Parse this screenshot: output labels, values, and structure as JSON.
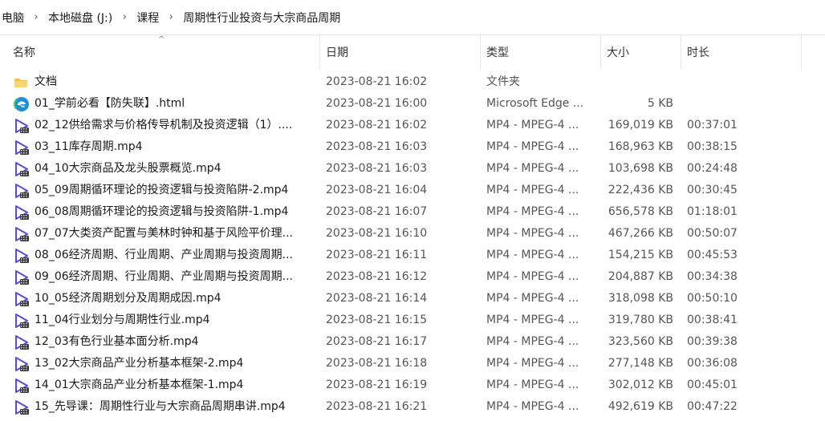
{
  "breadcrumb": [
    "电脑",
    "本地磁盘 (J:)",
    "课程",
    "周期性行业投资与大宗商品周期"
  ],
  "breadcrumb_separator": "›",
  "columns": {
    "name": "名称",
    "date": "日期",
    "type": "类型",
    "size": "大小",
    "duration": "时长"
  },
  "sort_indicator": "^",
  "colors": {
    "folder": "#f2c14e",
    "edge": "#1f8fd6",
    "video": "#5b4bd1"
  },
  "files": [
    {
      "icon": "folder-icon",
      "name": "文档",
      "date": "2023-08-21 16:02",
      "type": "文件夹",
      "size": "",
      "duration": ""
    },
    {
      "icon": "edge-browser-icon",
      "name": "01_学前必看【防失联】.html",
      "date": "2023-08-21 16:00",
      "type": "Microsoft Edge ...",
      "size": "5 KB",
      "duration": ""
    },
    {
      "icon": "video-file-icon",
      "name": "02_12供给需求与价格传导机制及投资逻辑（1）....",
      "date": "2023-08-21 16:02",
      "type": "MP4 - MPEG-4 ...",
      "size": "169,019 KB",
      "duration": "00:37:01"
    },
    {
      "icon": "video-file-icon",
      "name": "03_11库存周期.mp4",
      "date": "2023-08-21 16:03",
      "type": "MP4 - MPEG-4 ...",
      "size": "168,963 KB",
      "duration": "00:38:15"
    },
    {
      "icon": "video-file-icon",
      "name": "04_10大宗商品及龙头股票概览.mp4",
      "date": "2023-08-21 16:03",
      "type": "MP4 - MPEG-4 ...",
      "size": "103,698 KB",
      "duration": "00:24:48"
    },
    {
      "icon": "video-file-icon",
      "name": "05_09周期循环理论的投资逻辑与投资陷阱-2.mp4",
      "date": "2023-08-21 16:04",
      "type": "MP4 - MPEG-4 ...",
      "size": "222,436 KB",
      "duration": "00:30:45"
    },
    {
      "icon": "video-file-icon",
      "name": "06_08周期循环理论的投资逻辑与投资陷阱-1.mp4",
      "date": "2023-08-21 16:07",
      "type": "MP4 - MPEG-4 ...",
      "size": "656,578 KB",
      "duration": "01:18:01"
    },
    {
      "icon": "video-file-icon",
      "name": "07_07大类资产配置与美林时钟和基于风险平价理...",
      "date": "2023-08-21 16:10",
      "type": "MP4 - MPEG-4 ...",
      "size": "467,266 KB",
      "duration": "00:50:07"
    },
    {
      "icon": "video-file-icon",
      "name": "08_06经济周期、行业周期、产业周期与投资周期...",
      "date": "2023-08-21 16:11",
      "type": "MP4 - MPEG-4 ...",
      "size": "154,215 KB",
      "duration": "00:45:53"
    },
    {
      "icon": "video-file-icon",
      "name": "09_06经济周期、行业周期、产业周期与投资周期...",
      "date": "2023-08-21 16:12",
      "type": "MP4 - MPEG-4 ...",
      "size": "204,887 KB",
      "duration": "00:34:38"
    },
    {
      "icon": "video-file-icon",
      "name": "10_05经济周期划分及周期成因.mp4",
      "date": "2023-08-21 16:14",
      "type": "MP4 - MPEG-4 ...",
      "size": "318,098 KB",
      "duration": "00:50:10"
    },
    {
      "icon": "video-file-icon",
      "name": "11_04行业划分与周期性行业.mp4",
      "date": "2023-08-21 16:15",
      "type": "MP4 - MPEG-4 ...",
      "size": "319,780 KB",
      "duration": "00:38:41"
    },
    {
      "icon": "video-file-icon",
      "name": "12_03有色行业基本面分析.mp4",
      "date": "2023-08-21 16:17",
      "type": "MP4 - MPEG-4 ...",
      "size": "323,560 KB",
      "duration": "00:39:38"
    },
    {
      "icon": "video-file-icon",
      "name": "13_02大宗商品产业分析基本框架-2.mp4",
      "date": "2023-08-21 16:18",
      "type": "MP4 - MPEG-4 ...",
      "size": "277,148 KB",
      "duration": "00:36:08"
    },
    {
      "icon": "video-file-icon",
      "name": "14_01大宗商品产业分析基本框架-1.mp4",
      "date": "2023-08-21 16:19",
      "type": "MP4 - MPEG-4 ...",
      "size": "302,012 KB",
      "duration": "00:45:01"
    },
    {
      "icon": "video-file-icon",
      "name": "15_先导课：周期性行业与大宗商品周期串讲.mp4",
      "date": "2023-08-21 16:21",
      "type": "MP4 - MPEG-4 ...",
      "size": "492,619 KB",
      "duration": "00:47:22"
    }
  ]
}
